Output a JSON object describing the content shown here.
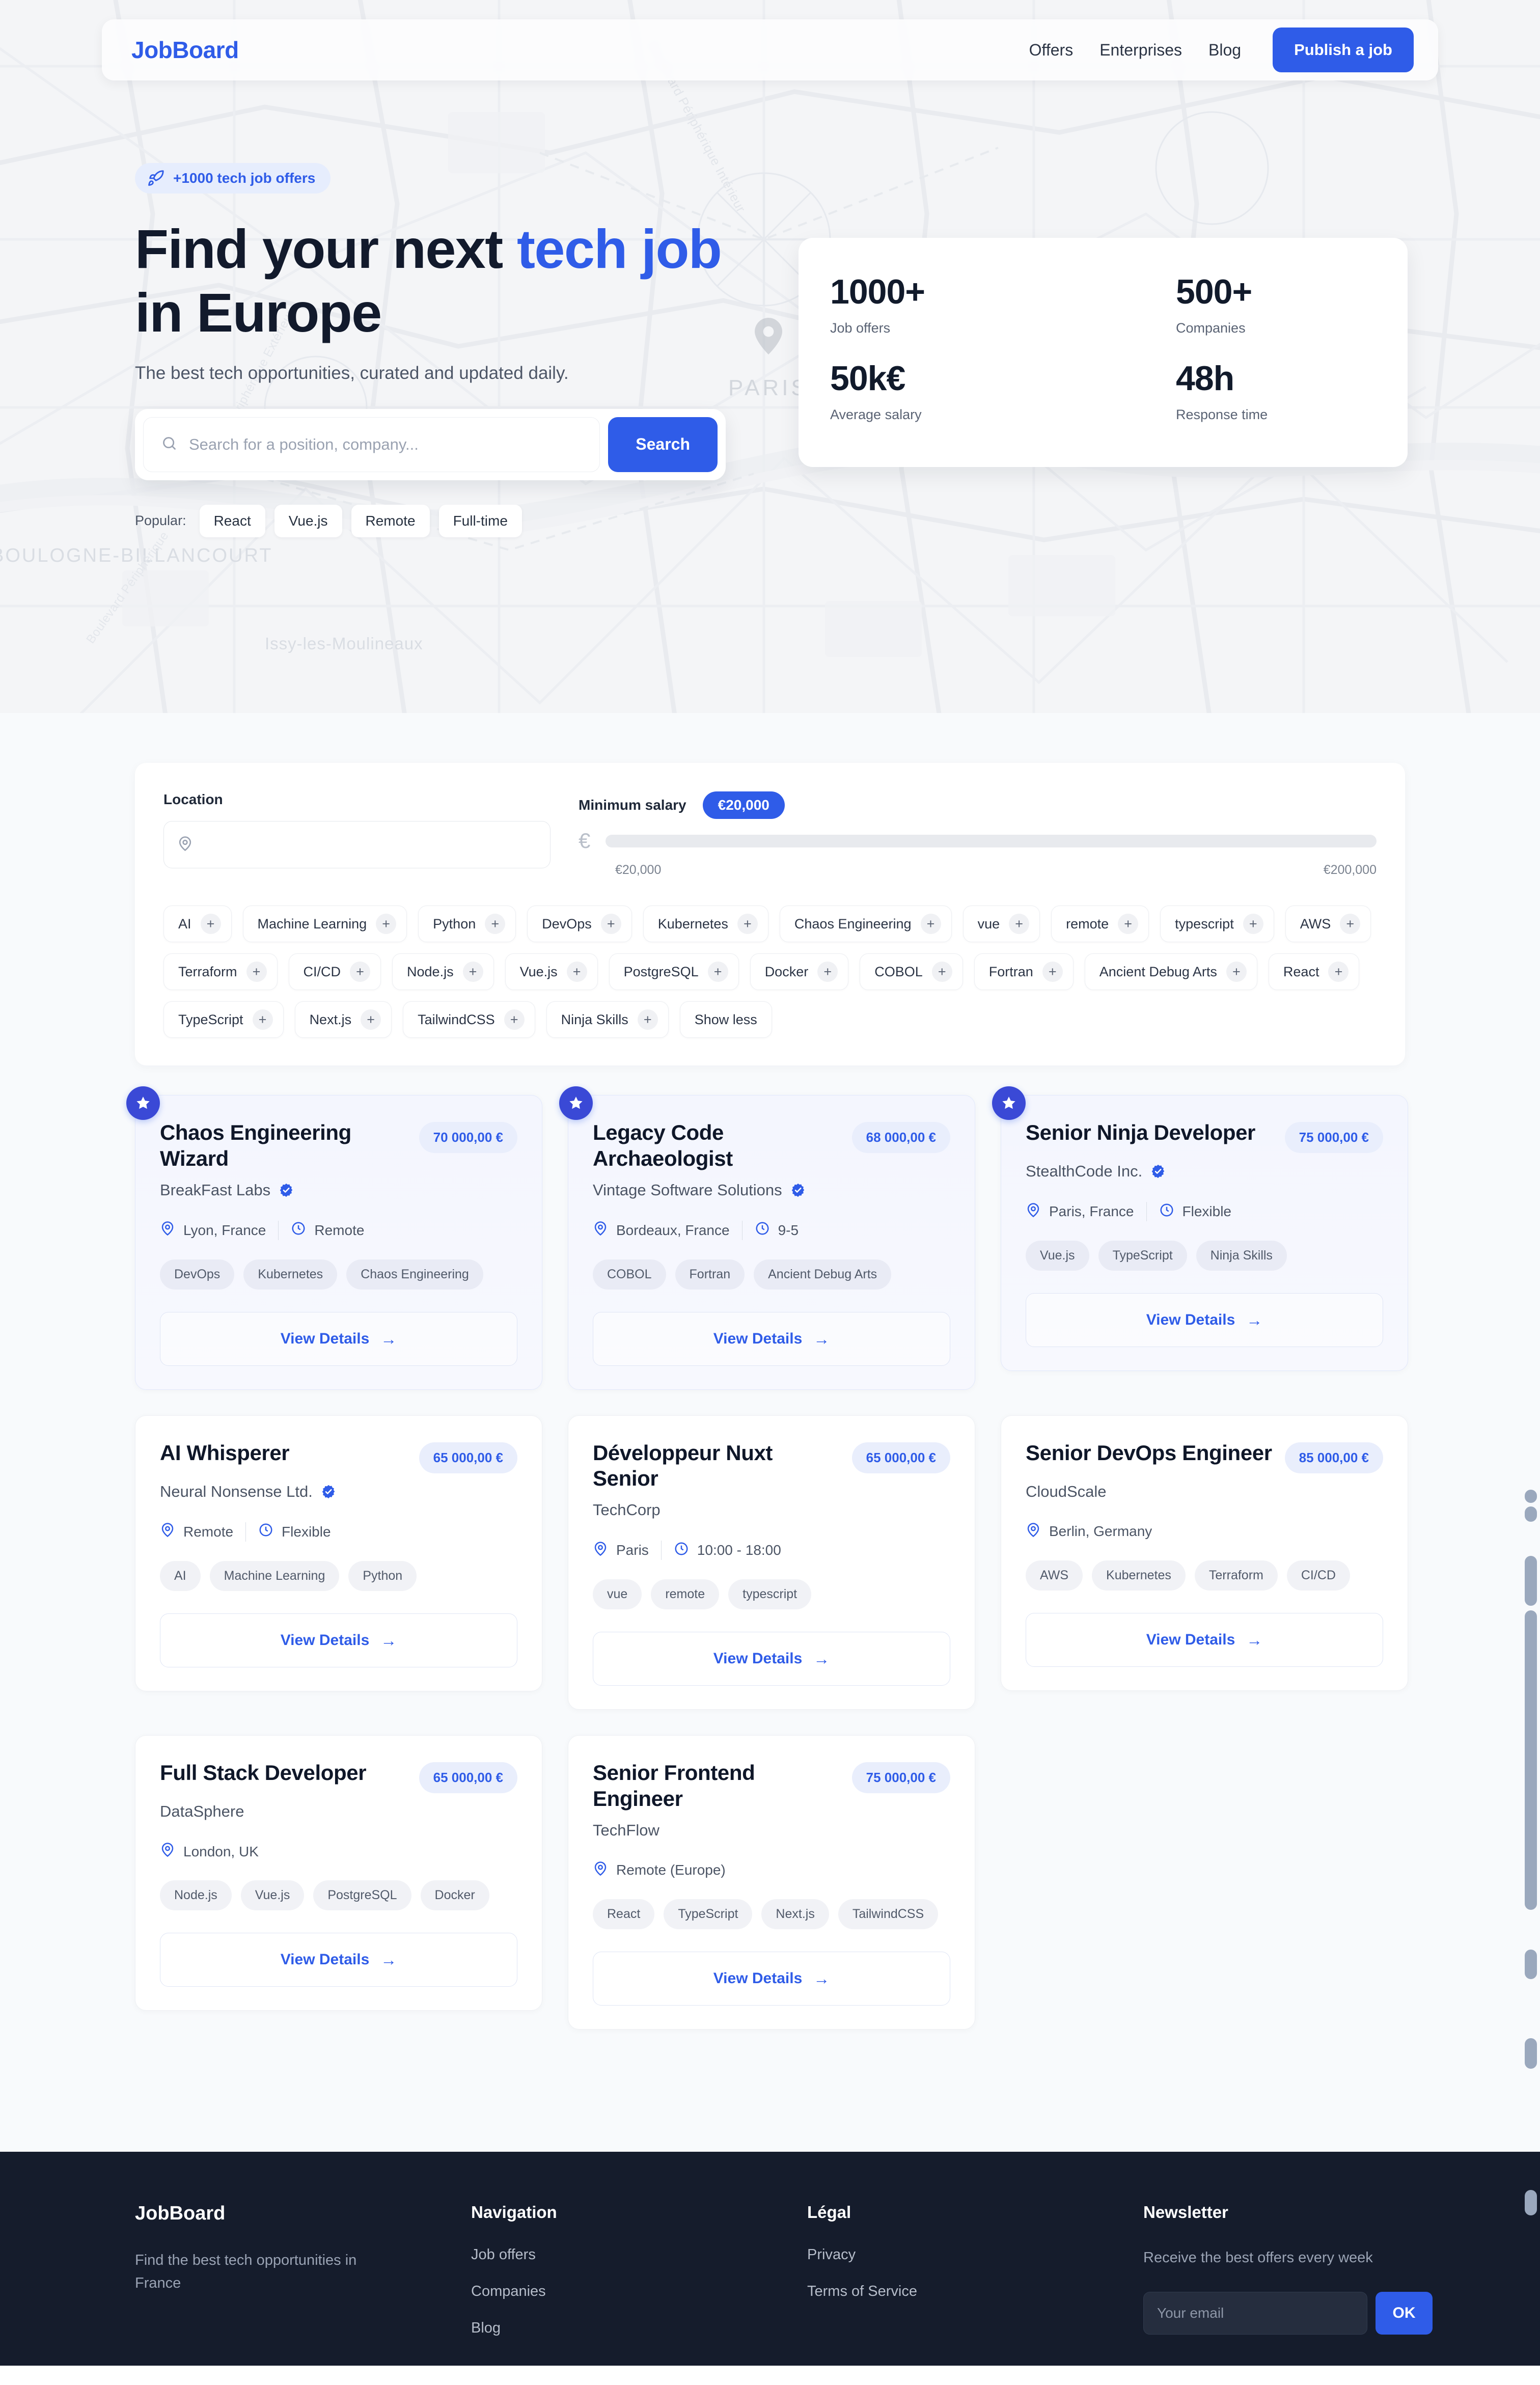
{
  "brand": "JobBoard",
  "nav": {
    "links": [
      "Offers",
      "Enterprises",
      "Blog"
    ],
    "cta": "Publish a job"
  },
  "hero": {
    "badge": "+1000 tech job offers",
    "title_part1": "Find your next ",
    "title_accent": "tech job",
    "title_part2": " in Europe",
    "subtitle": "The best tech opportunities, curated and updated daily.",
    "search_placeholder": "Search for a position, company...",
    "search_value": "",
    "search_button": "Search",
    "popular_label": "Popular:",
    "popular_chips": [
      "React",
      "Vue.js",
      "Remote",
      "Full-time"
    ],
    "map_labels": {
      "paris": "PARIS",
      "boulogne": "BOULOGNE-BILLANCOURT",
      "issy": "Issy-les-Moulineaux",
      "periph_interieur": "Boulevard Périphérique Intérieur",
      "periph_exterieur": "Boulevard Périphérique Extérieur",
      "periph_seine": "Boulevard Périphérique"
    }
  },
  "stats": [
    {
      "value": "1000+",
      "label": "Job offers"
    },
    {
      "value": "500+",
      "label": "Companies"
    },
    {
      "value": "50k€",
      "label": "Average salary"
    },
    {
      "value": "48h",
      "label": "Response time"
    }
  ],
  "filters": {
    "location_label": "Location",
    "location_placeholder": "",
    "location_value": "",
    "salary_label": "Minimum salary",
    "salary_badge": "€20,000",
    "salary_min_label": "€20,000",
    "salary_max_label": "€200,000",
    "salary_value": 20000,
    "salary_range": [
      20000,
      200000
    ],
    "tags": [
      "AI",
      "Machine Learning",
      "Python",
      "DevOps",
      "Kubernetes",
      "Chaos Engineering",
      "vue",
      "remote",
      "typescript",
      "AWS",
      "Terraform",
      "CI/CD",
      "Node.js",
      "Vue.js",
      "PostgreSQL",
      "Docker",
      "COBOL",
      "Fortran",
      "Ancient Debug Arts",
      "React",
      "TypeScript",
      "Next.js",
      "TailwindCSS",
      "Ninja Skills"
    ],
    "show_less": "Show less"
  },
  "jobs": [
    {
      "featured": true,
      "title": "Chaos Engineering Wizard",
      "company": "BreakFast Labs",
      "verified": true,
      "salary": "70 000,00 €",
      "location": "Lyon, France",
      "schedule": "Remote",
      "tags": [
        "DevOps",
        "Kubernetes",
        "Chaos Engineering"
      ],
      "cta": "View Details"
    },
    {
      "featured": true,
      "title": "Legacy Code Archaeologist",
      "company": "Vintage Software Solutions",
      "verified": true,
      "salary": "68 000,00 €",
      "location": "Bordeaux, France",
      "schedule": "9-5",
      "tags": [
        "COBOL",
        "Fortran",
        "Ancient Debug Arts"
      ],
      "cta": "View Details"
    },
    {
      "featured": true,
      "title": "Senior Ninja Developer",
      "company": "StealthCode Inc.",
      "verified": true,
      "salary": "75 000,00 €",
      "location": "Paris, France",
      "schedule": "Flexible",
      "tags": [
        "Vue.js",
        "TypeScript",
        "Ninja Skills"
      ],
      "cta": "View Details"
    },
    {
      "featured": false,
      "title": "AI Whisperer",
      "company": "Neural Nonsense Ltd.",
      "verified": true,
      "salary": "65 000,00 €",
      "location": "Remote",
      "schedule": "Flexible",
      "tags": [
        "AI",
        "Machine Learning",
        "Python"
      ],
      "cta": "View Details"
    },
    {
      "featured": false,
      "title": "Développeur Nuxt Senior",
      "company": "TechCorp",
      "verified": false,
      "salary": "65 000,00 €",
      "location": "Paris",
      "schedule": "10:00 - 18:00",
      "tags": [
        "vue",
        "remote",
        "typescript"
      ],
      "cta": "View Details"
    },
    {
      "featured": false,
      "title": "Senior DevOps Engineer",
      "company": "CloudScale",
      "verified": false,
      "salary": "85 000,00 €",
      "location": "Berlin, Germany",
      "schedule": "",
      "tags": [
        "AWS",
        "Kubernetes",
        "Terraform",
        "CI/CD"
      ],
      "cta": "View Details"
    },
    {
      "featured": false,
      "title": "Full Stack Developer",
      "company": "DataSphere",
      "verified": false,
      "salary": "65 000,00 €",
      "location": "London, UK",
      "schedule": "",
      "tags": [
        "Node.js",
        "Vue.js",
        "PostgreSQL",
        "Docker"
      ],
      "cta": "View Details"
    },
    {
      "featured": false,
      "title": "Senior Frontend Engineer",
      "company": "TechFlow",
      "verified": false,
      "salary": "75 000,00 €",
      "location": "Remote (Europe)",
      "schedule": "",
      "tags": [
        "React",
        "TypeScript",
        "Next.js",
        "TailwindCSS"
      ],
      "cta": "View Details"
    }
  ],
  "footer": {
    "brand": "JobBoard",
    "tagline": "Find the best tech opportunities in France",
    "nav_head": "Navigation",
    "nav_links": [
      "Job offers",
      "Companies",
      "Blog"
    ],
    "legal_head": "Légal",
    "legal_links": [
      "Privacy",
      "Terms of Service"
    ],
    "news_head": "Newsletter",
    "news_text": "Receive the best offers every week",
    "news_placeholder": "Your email",
    "news_value": "",
    "news_button": "OK"
  },
  "colors": {
    "accent": "#2f5ce8",
    "ink": "#0f1729",
    "footer_bg": "#151c2c",
    "page_bg": "#f8fafc"
  }
}
